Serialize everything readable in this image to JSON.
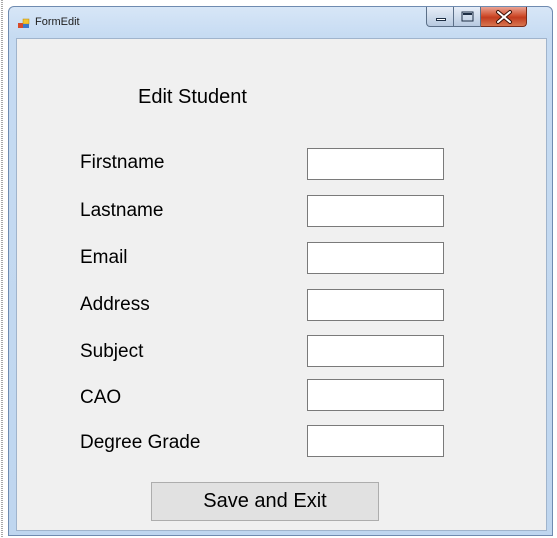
{
  "window": {
    "title": "FormEdit",
    "controls": {
      "minimize": "minimize-icon",
      "maximize": "maximize-icon",
      "close": "close-icon"
    },
    "app_icon": "form-app-icon"
  },
  "form": {
    "heading": "Edit Student",
    "fields": [
      {
        "label": "Firstname",
        "value": ""
      },
      {
        "label": "Lastname",
        "value": ""
      },
      {
        "label": "Email",
        "value": ""
      },
      {
        "label": "Address",
        "value": ""
      },
      {
        "label": "Subject",
        "value": ""
      },
      {
        "label": "CAO",
        "value": ""
      },
      {
        "label": "Degree Grade",
        "value": ""
      }
    ],
    "save_label": "Save and Exit"
  },
  "colors": {
    "client_background": "#f0f0f0",
    "button_face": "#e1e1e1",
    "close_button_red": "#c23c1f",
    "window_frame_blue": "#c6dbf2"
  }
}
